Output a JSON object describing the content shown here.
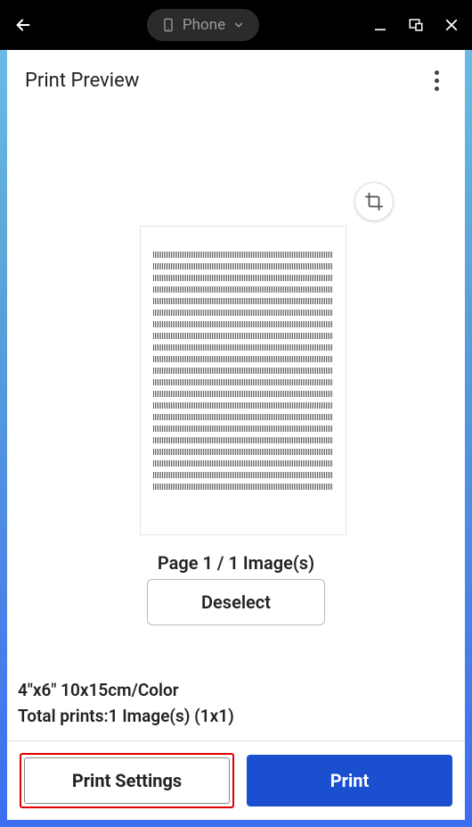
{
  "emulator": {
    "device_label": "Phone"
  },
  "header": {
    "title": "Print Preview"
  },
  "preview": {
    "page_info": "Page 1 / 1 Image(s)",
    "deselect_label": "Deselect"
  },
  "summary": {
    "media": "4\"x6\" 10x15cm/Color",
    "totals": "Total prints:1 Image(s) (1x1)"
  },
  "actions": {
    "settings_label": "Print Settings",
    "print_label": "Print"
  }
}
